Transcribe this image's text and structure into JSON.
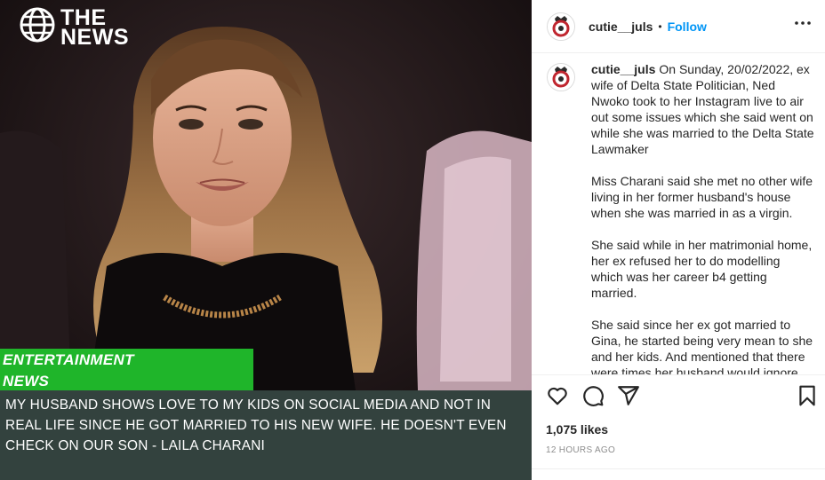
{
  "brand": {
    "line1": "THE",
    "line2": "NEWS"
  },
  "media": {
    "tag_line1": "ENTERTAINMENT",
    "tag_line2": "NEWS",
    "headline": "MY HUSBAND SHOWS LOVE TO MY KIDS ON SOCIAL MEDIA AND NOT IN REAL LIFE SINCE HE GOT MARRIED TO HIS NEW WIFE. HE DOESN'T EVEN CHECK ON OUR SON - LAILA CHARANI"
  },
  "header": {
    "username": "cutie__juls",
    "separator": "•",
    "follow_label": "Follow"
  },
  "caption": {
    "username": "cutie__juls",
    "paragraphs": [
      "On Sunday, 20/02/2022, ex wife of Delta State Politician, Ned Nwoko took to her Instagram live to air out some issues which she said went on while she was married to the Delta State Lawmaker",
      "Miss Charani said she met no other wife living in her former husband's house when she was married in as a virgin.",
      "She said while in her matrimonial home, her ex refused her to do modelling which was her career b4 getting married.",
      "She said since her ex got married to Gina, he started being very mean to she and her kids. And mentioned that there were times her husband would ignore the cry of her kids and ignore her calls."
    ]
  },
  "actions": {
    "likes": "1,075 likes",
    "timestamp": "12 HOURS AGO"
  },
  "colors": {
    "accent": "#0095f6",
    "tag_green": "#1fb52a",
    "headline_bg": "#33423e"
  },
  "icons": [
    "globe-icon",
    "more-options-icon",
    "heart-icon",
    "comment-icon",
    "share-icon",
    "bookmark-icon"
  ]
}
